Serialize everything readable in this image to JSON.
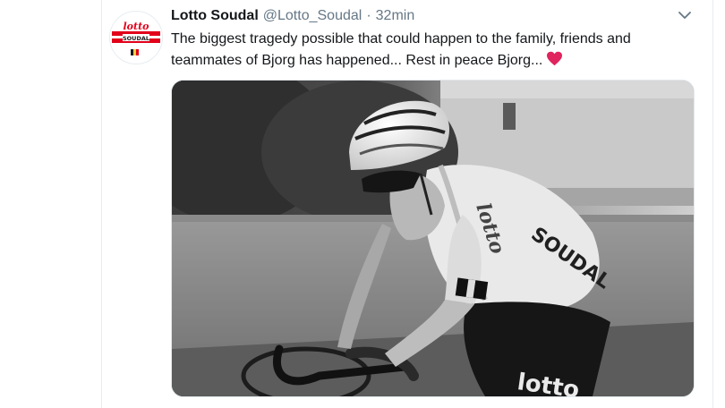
{
  "tweet": {
    "display_name": "Lotto Soudal",
    "handle": "@Lotto_Soudal",
    "separator": "·",
    "time": "32min",
    "text": "The biggest tragedy possible that could happen to the family, friends and teammates of Bjorg has happened... Rest in peace Bjorg...",
    "emoji": "red-heart-icon"
  },
  "avatar": {
    "logo_top": "lotto",
    "logo_bottom": "SOUDAL"
  },
  "photo": {
    "jersey_text": "SOUDAL",
    "shorts_text": "lotto",
    "style": "black-and-white"
  },
  "colors": {
    "name": "#14171a",
    "muted": "#657786",
    "heart": "#e0245e",
    "brand_red": "#e2001a"
  }
}
